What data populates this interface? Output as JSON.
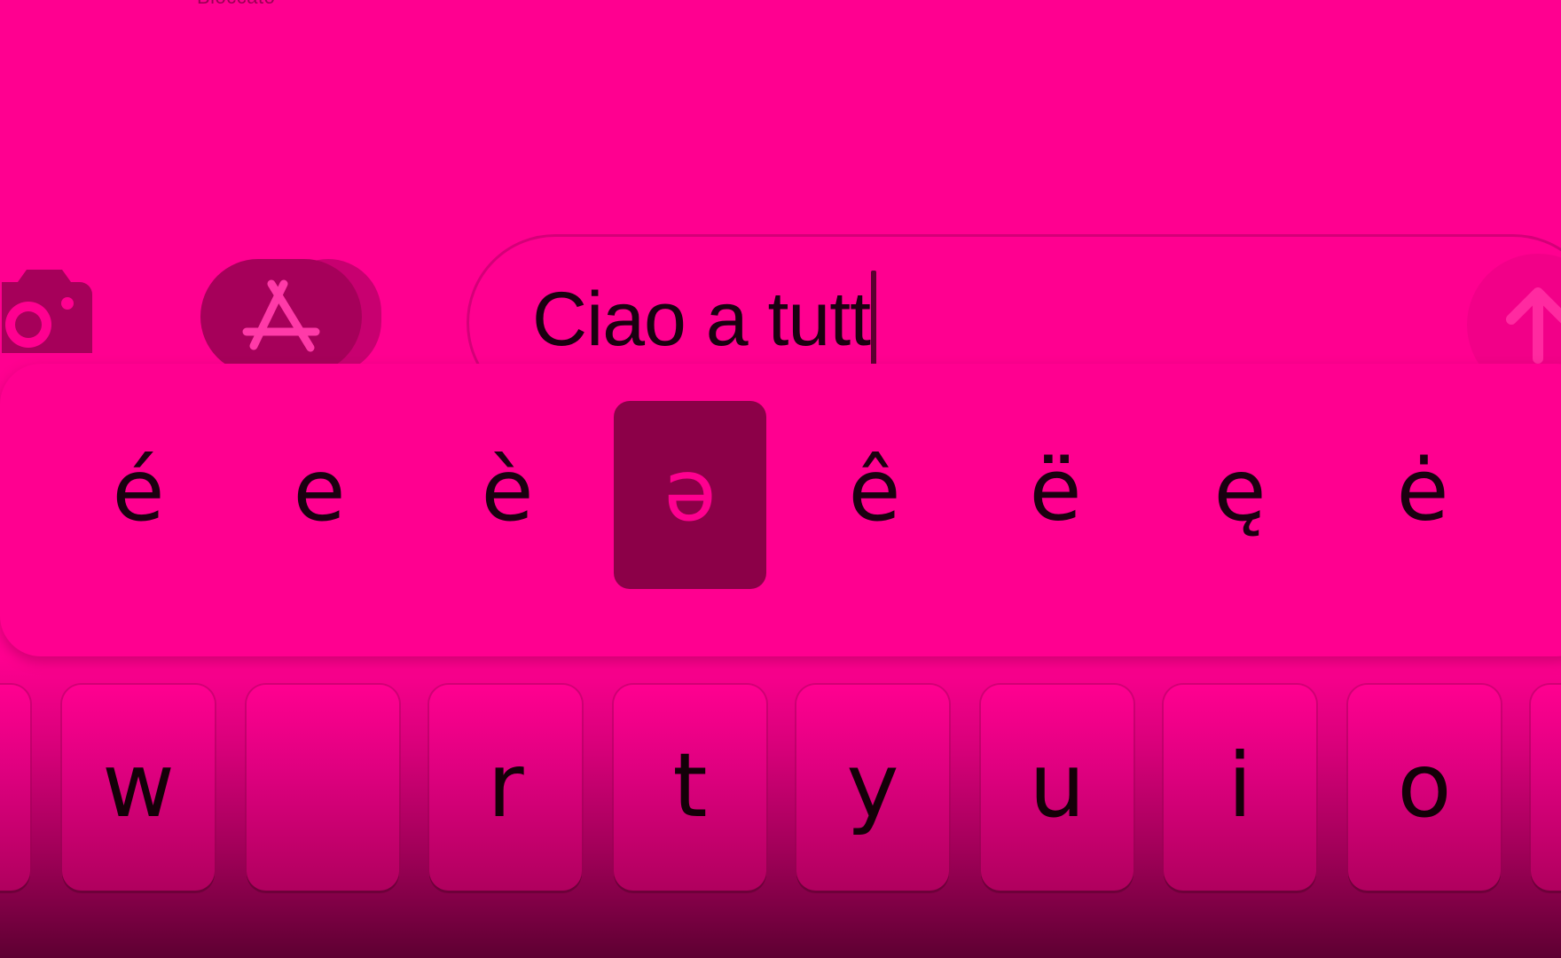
{
  "status": {
    "top_label": "Bloccato"
  },
  "compose": {
    "message_text": "Ciao a tutt",
    "camera_icon": "camera-icon",
    "appstore_icon": "app-store-icon",
    "send_icon": "arrow-up-icon"
  },
  "accent_popup": {
    "options": [
      "é",
      "e",
      "è",
      "ə",
      "ê",
      "ë",
      "ę",
      "ė"
    ],
    "selected": "ə"
  },
  "keyboard": {
    "top_row_keys": [
      "w",
      "r",
      "t",
      "y",
      "u",
      "i",
      "o"
    ]
  },
  "colors": {
    "tint": "#FF0090",
    "selected_accent_bg": "#8C0048",
    "key_text": "#140008"
  }
}
